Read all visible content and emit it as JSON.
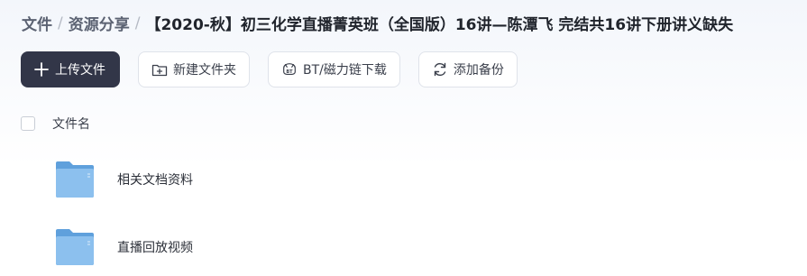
{
  "breadcrumb": {
    "items": [
      "文件",
      "资源分享"
    ],
    "separator": "/",
    "current": "【2020-秋】初三化学直播菁英班（全国版）16讲—陈潭飞 完结共16讲下册讲义缺失"
  },
  "toolbar": {
    "upload_label": "上传文件",
    "new_folder_label": "新建文件夹",
    "bt_download_label": "BT/磁力链下载",
    "add_backup_label": "添加备份"
  },
  "list": {
    "column_name": "文件名",
    "items": [
      {
        "name": "相关文档资料",
        "icon": "folder-icon"
      },
      {
        "name": "直播回放视频",
        "icon": "folder-icon"
      }
    ]
  },
  "colors": {
    "primary_button": "#323648",
    "folder": "#7ab3e6"
  }
}
